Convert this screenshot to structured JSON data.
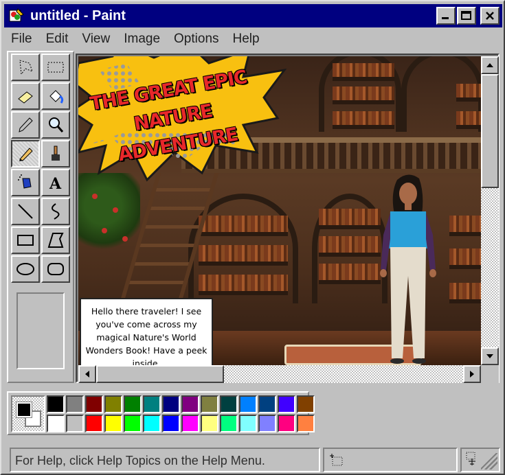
{
  "window": {
    "title": "untitled - Paint",
    "buttons": {
      "minimize": "minimize",
      "maximize": "maximize",
      "close": "close"
    }
  },
  "menu": [
    "File",
    "Edit",
    "View",
    "Image",
    "Options",
    "Help"
  ],
  "tools": [
    {
      "name": "free-form-select-icon",
      "active": false
    },
    {
      "name": "rect-select-icon",
      "active": false
    },
    {
      "name": "eraser-icon",
      "active": false
    },
    {
      "name": "fill-bucket-icon",
      "active": false
    },
    {
      "name": "color-picker-icon",
      "active": false
    },
    {
      "name": "magnifier-icon",
      "active": false
    },
    {
      "name": "pencil-icon",
      "active": true
    },
    {
      "name": "brush-icon",
      "active": false
    },
    {
      "name": "airbrush-icon",
      "active": false
    },
    {
      "name": "text-icon",
      "active": false
    },
    {
      "name": "line-icon",
      "active": false
    },
    {
      "name": "curve-icon",
      "active": false
    },
    {
      "name": "rectangle-icon",
      "active": false
    },
    {
      "name": "polygon-icon",
      "active": false
    },
    {
      "name": "ellipse-icon",
      "active": false
    },
    {
      "name": "rounded-rectangle-icon",
      "active": false
    }
  ],
  "canvas": {
    "title_line1": "THE GREAT EPIC",
    "title_line2": "NATURE ADVENTURE",
    "speech": "Hello there traveler! I see you've come across my magical Nature's World Wonders Book! Have a peek inside."
  },
  "colors": {
    "foreground": "#000000",
    "background": "#ffffff",
    "palette_top": [
      "#000000",
      "#808080",
      "#800000",
      "#808000",
      "#008000",
      "#008080",
      "#000080",
      "#800080",
      "#808040",
      "#004040",
      "#0080ff",
      "#004080",
      "#4000ff",
      "#804000"
    ],
    "palette_bottom": [
      "#ffffff",
      "#c0c0c0",
      "#ff0000",
      "#ffff00",
      "#00ff00",
      "#00ffff",
      "#0000ff",
      "#ff00ff",
      "#ffff80",
      "#00ff80",
      "#80ffff",
      "#8080ff",
      "#ff0080",
      "#ff8040"
    ]
  },
  "status": {
    "help_text": "For Help, click Help Topics on the Help Menu."
  }
}
